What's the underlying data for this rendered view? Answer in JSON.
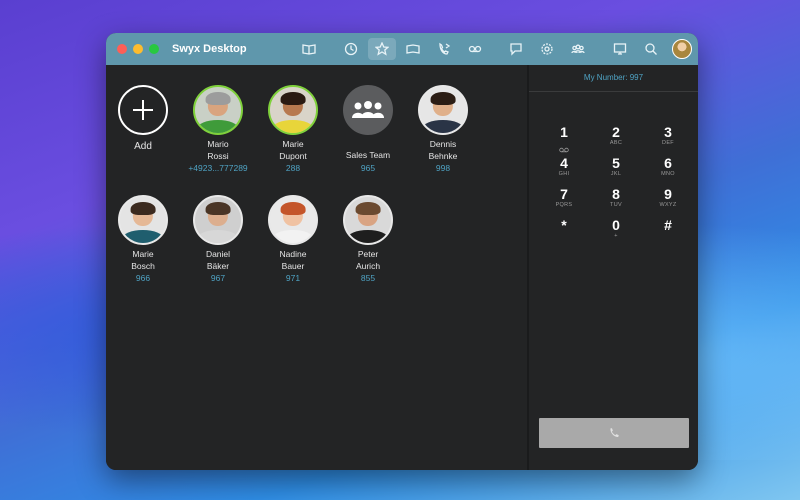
{
  "app": {
    "title": "Swyx Desktop"
  },
  "toolbar": [
    {
      "name": "phonebook-icon"
    },
    {
      "name": "history-icon"
    },
    {
      "name": "favorites-icon",
      "active": true
    },
    {
      "name": "book-icon"
    },
    {
      "name": "call-forward-icon"
    },
    {
      "name": "voicemail-icon"
    },
    {
      "name": "chat-icon"
    },
    {
      "name": "settings-icon"
    },
    {
      "name": "conference-icon"
    },
    {
      "name": "screen-icon"
    },
    {
      "name": "search-icon"
    }
  ],
  "favorites": {
    "add_label": "Add",
    "contacts": [
      {
        "first": "Mario",
        "last": "Rossi",
        "number": "+4923...777289",
        "online": true,
        "skin": "#d9a47e",
        "hair": "#9c9c9c",
        "shirt": "#3f9b3a",
        "bg": "#c9d0c6"
      },
      {
        "first": "Marie",
        "last": "Dupont",
        "number": "288",
        "online": true,
        "skin": "#b7794f",
        "hair": "#2a1a12",
        "shirt": "#e8d53a",
        "bg": "#d9d4c9"
      },
      {
        "first": "Sales Team",
        "last": "",
        "number": "965",
        "group": true
      },
      {
        "first": "Dennis",
        "last": "Behnke",
        "number": "998",
        "online": false,
        "skin": "#e0b08a",
        "hair": "#2b1d14",
        "shirt": "#2a3446",
        "bg": "#e6e6e6"
      },
      {
        "first": "Marie",
        "last": "Bosch",
        "number": "966",
        "online": false,
        "skin": "#e5b896",
        "hair": "#3b2a1f",
        "shirt": "#1f5e6e",
        "bg": "#e4e4e4"
      },
      {
        "first": "Daniel",
        "last": "Bäker",
        "number": "967",
        "online": false,
        "skin": "#dcae8e",
        "hair": "#4a3526",
        "shirt": "#d7d7d7",
        "bg": "#cfcfcf"
      },
      {
        "first": "Nadine",
        "last": "Bauer",
        "number": "971",
        "online": false,
        "skin": "#f0c2a2",
        "hair": "#c4552a",
        "shirt": "#f2f2f2",
        "bg": "#e9e9e9"
      },
      {
        "first": "Peter",
        "last": "Aurich",
        "number": "855",
        "online": false,
        "skin": "#d9a483",
        "hair": "#6b4a30",
        "shirt": "#1e1e1e",
        "bg": "#d9d9d9"
      }
    ]
  },
  "dialer": {
    "my_number": "My Number: 997",
    "keys": [
      {
        "digit": "1",
        "letters": "voicemail-glyph"
      },
      {
        "digit": "2",
        "letters": "ABC"
      },
      {
        "digit": "3",
        "letters": "DEF"
      },
      {
        "digit": "4",
        "letters": "GHI"
      },
      {
        "digit": "5",
        "letters": "JKL"
      },
      {
        "digit": "6",
        "letters": "MNO"
      },
      {
        "digit": "7",
        "letters": "PQRS"
      },
      {
        "digit": "8",
        "letters": "TUV"
      },
      {
        "digit": "9",
        "letters": "WXYZ"
      },
      {
        "digit": "*",
        "letters": ""
      },
      {
        "digit": "0",
        "letters": "+"
      },
      {
        "digit": "#",
        "letters": ""
      }
    ],
    "call_icon": "phone-icon"
  },
  "colors": {
    "accent": "#4fa3c4",
    "titlebar": "#5f97ac",
    "online": "#7fd13b",
    "window_bg": "#232425"
  }
}
